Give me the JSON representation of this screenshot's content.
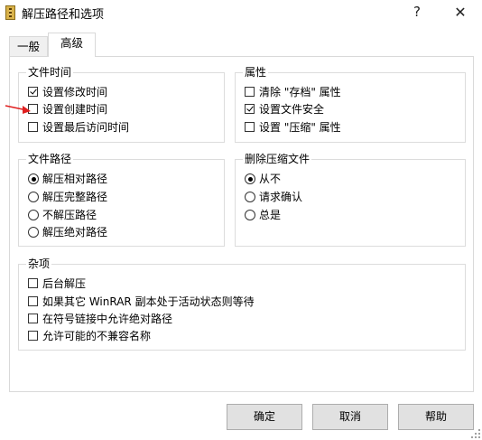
{
  "window": {
    "title": "解压路径和选项",
    "help_glyph": "?",
    "close_glyph": "✕",
    "icon": "winrar-archive-icon"
  },
  "tabs": [
    {
      "label": "一般",
      "active": false
    },
    {
      "label": "高级",
      "active": true
    }
  ],
  "file_time": {
    "title": "文件时间",
    "options": [
      {
        "label": "设置修改时间",
        "checked": true
      },
      {
        "label": "设置创建时间",
        "checked": false
      },
      {
        "label": "设置最后访问时间",
        "checked": false
      }
    ]
  },
  "attributes": {
    "title": "属性",
    "options": [
      {
        "label": "清除 \"存档\" 属性",
        "checked": false
      },
      {
        "label": "设置文件安全",
        "checked": true
      },
      {
        "label": "设置 \"压缩\" 属性",
        "checked": false
      }
    ]
  },
  "file_path": {
    "title": "文件路径",
    "options": [
      {
        "label": "解压相对路径",
        "selected": true
      },
      {
        "label": "解压完整路径",
        "selected": false
      },
      {
        "label": "不解压路径",
        "selected": false
      },
      {
        "label": "解压绝对路径",
        "selected": false
      }
    ]
  },
  "delete_archive": {
    "title": "删除压缩文件",
    "options": [
      {
        "label": "从不",
        "selected": true
      },
      {
        "label": "请求确认",
        "selected": false
      },
      {
        "label": "总是",
        "selected": false
      }
    ]
  },
  "misc": {
    "title": "杂项",
    "options": [
      {
        "label": "后台解压",
        "checked": false
      },
      {
        "label": "如果其它 WinRAR 副本处于活动状态则等待",
        "checked": false
      },
      {
        "label": "在符号链接中允许绝对路径",
        "checked": false
      },
      {
        "label": "允许可能的不兼容名称",
        "checked": false
      }
    ]
  },
  "buttons": {
    "ok": "确定",
    "cancel": "取消",
    "help": "帮助"
  },
  "colors": {
    "annotation_arrow": "#e02020",
    "button_face": "#e1e1e1",
    "group_border": "#dcdcdc"
  }
}
